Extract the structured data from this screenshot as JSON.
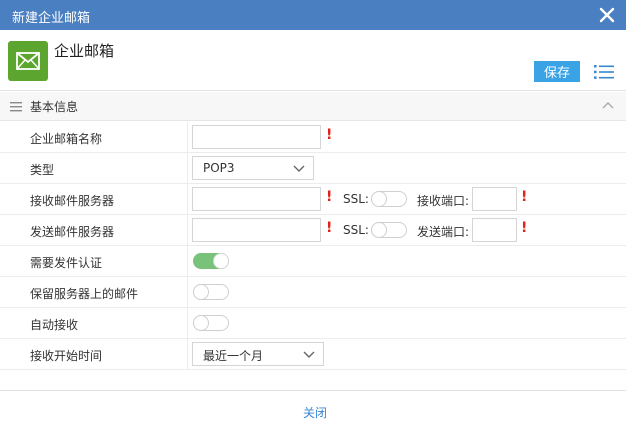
{
  "dialog": {
    "title": "新建企业邮箱",
    "close_icon": "close-icon"
  },
  "header": {
    "app_title": "企业邮箱",
    "app_icon": "mail-icon",
    "app_icon_color": "#5ca52f",
    "save_label": "保存",
    "list_icon": "list-icon"
  },
  "section": {
    "title": "基本信息"
  },
  "form": {
    "mailbox_name": {
      "label": "企业邮箱名称",
      "value": "",
      "required_mark": "!"
    },
    "type": {
      "label": "类型",
      "selected": "POP3"
    },
    "incoming_server": {
      "label": "接收邮件服务器",
      "value": "",
      "required_mark": "!",
      "ssl_label": "SSL:",
      "ssl_on": false,
      "port_label": "接收端口:",
      "port_value": "",
      "port_required_mark": "!"
    },
    "outgoing_server": {
      "label": "发送邮件服务器",
      "value": "",
      "required_mark": "!",
      "ssl_label": "SSL:",
      "ssl_on": false,
      "port_label": "发送端口:",
      "port_value": "",
      "port_required_mark": "!"
    },
    "requires_auth": {
      "label": "需要发件认证",
      "on": true
    },
    "keep_on_server": {
      "label": "保留服务器上的邮件",
      "on": false
    },
    "auto_receive": {
      "label": "自动接收",
      "on": false
    },
    "receive_start": {
      "label": "接收开始时间",
      "selected": "最近一个月"
    }
  },
  "footer": {
    "close_label": "关闭"
  },
  "colors": {
    "titlebar": "#4a7fc1",
    "accent": "#3aa3e6",
    "required": "#e0201a",
    "toggle_on": "#78c27a",
    "link": "#3a86d4"
  }
}
